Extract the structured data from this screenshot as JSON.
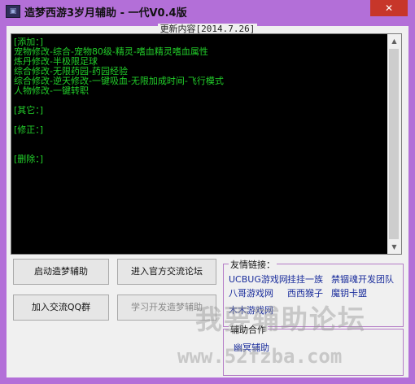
{
  "window": {
    "title": "造梦西游3岁月辅助 - 一代V0.4版",
    "close_glyph": "✕"
  },
  "update_panel": {
    "title": "更新内容[2014.7.26]",
    "lines": [
      "[添加：]",
      "宠物修改-综合-宠物80级-精灵-嗜血精灵嗜血属性",
      "炼丹修改-半极限足球",
      "综合修改-无限药园-药园经验",
      "综合修改-逆天修改-一键吸血-无限加成时间-飞行模式",
      "人物修改-一键转职",
      "",
      "[其它：]",
      "",
      "[修正：]",
      "",
      "",
      "[删除：]"
    ]
  },
  "buttons": {
    "start": "启动造梦辅助",
    "forum": "进入官方交流论坛",
    "qq_group": "加入交流QQ群",
    "learn_dev": "学习开发造梦辅助"
  },
  "friend_links": {
    "label": "友情链接：",
    "items": [
      "UCBUG游戏网",
      "挂挂一族",
      "禁锢魂开发团队",
      "八哥游戏网",
      "西西猴子",
      "魔钥卡盟",
      "木木游戏网"
    ]
  },
  "partner": {
    "label": "辅助合作",
    "items": [
      "幽冥辅助"
    ]
  },
  "watermark": {
    "text": "我要辅助论坛",
    "url": "www.52fzba.com"
  }
}
